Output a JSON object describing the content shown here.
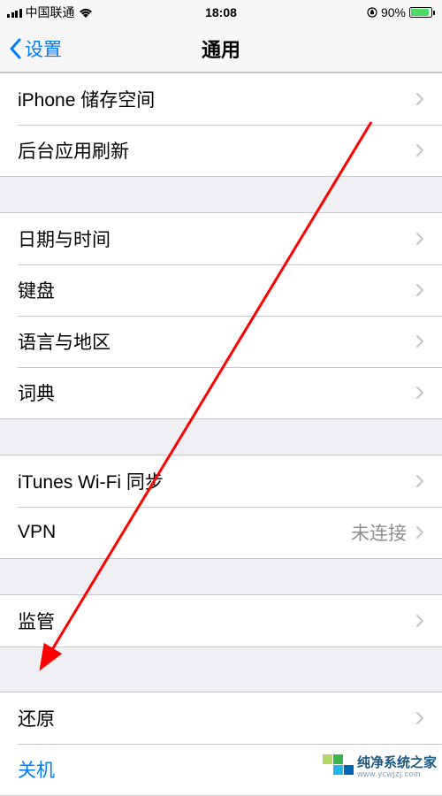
{
  "status": {
    "carrier": "中国联通",
    "time": "18:08",
    "battery_pct": "90%"
  },
  "nav": {
    "back_label": "设置",
    "title": "通用"
  },
  "groups": [
    {
      "rows": [
        {
          "label": "iPhone 储存空间"
        },
        {
          "label": "后台应用刷新"
        }
      ]
    },
    {
      "rows": [
        {
          "label": "日期与时间"
        },
        {
          "label": "键盘"
        },
        {
          "label": "语言与地区"
        },
        {
          "label": "词典"
        }
      ]
    },
    {
      "rows": [
        {
          "label": "iTunes Wi-Fi 同步"
        },
        {
          "label": "VPN",
          "value": "未连接"
        }
      ]
    },
    {
      "rows": [
        {
          "label": "监管"
        }
      ]
    },
    {
      "rows": [
        {
          "label": "还原"
        },
        {
          "label": "关机",
          "action": true,
          "no_chevron": true
        }
      ]
    }
  ],
  "watermark": {
    "cn": "纯净系统之家",
    "en": "www.ycwjzj.com"
  }
}
